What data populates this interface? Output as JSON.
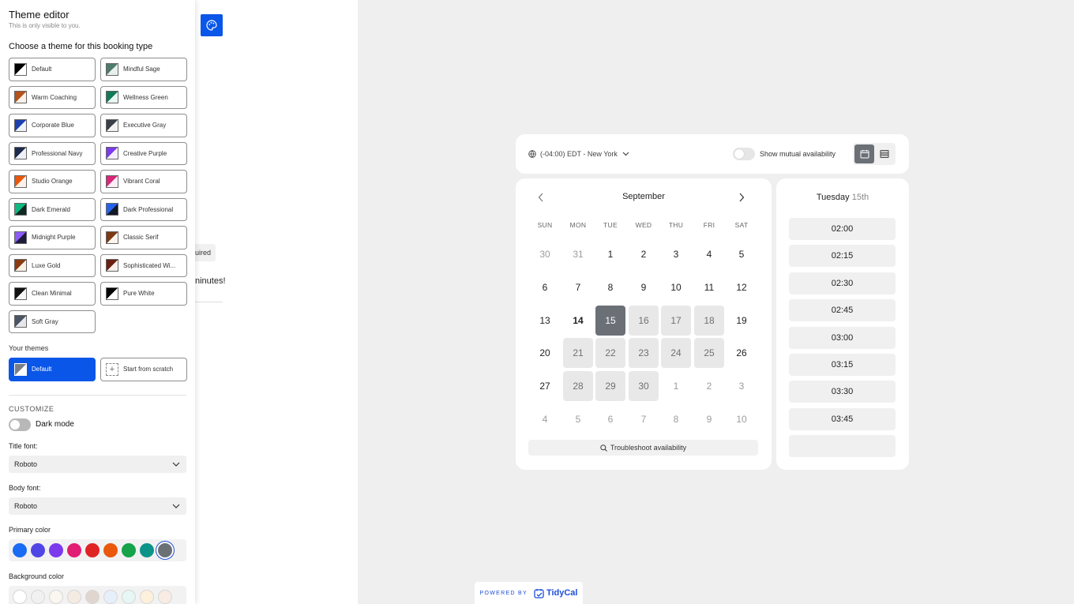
{
  "editor": {
    "title": "Theme editor",
    "subtitle": "This is only visible to you.",
    "choose_label": "Choose a theme for this booking type",
    "themes": [
      {
        "label": "Default",
        "c1": "#000000",
        "c2": "#ffffff"
      },
      {
        "label": "Mindful Sage",
        "c1": "#4f7a6e",
        "c2": "#e9efec"
      },
      {
        "label": "Warm Coaching",
        "c1": "#b4521b",
        "c2": "#fbf1e8"
      },
      {
        "label": "Wellness Green",
        "c1": "#0f7a53",
        "c2": "#e9f5ef"
      },
      {
        "label": "Corporate Blue",
        "c1": "#1e40af",
        "c2": "#eef3fb"
      },
      {
        "label": "Executive Gray",
        "c1": "#3b3f47",
        "c2": "#f3f3f4"
      },
      {
        "label": "Professional Navy",
        "c1": "#1e2b4f",
        "c2": "#eef1f7"
      },
      {
        "label": "Creative Purple",
        "c1": "#7c3aed",
        "c2": "#f4effd"
      },
      {
        "label": "Studio Orange",
        "c1": "#ea580c",
        "c2": "#fdf2ea"
      },
      {
        "label": "Vibrant Coral",
        "c1": "#db2777",
        "c2": "#fdeef5"
      },
      {
        "label": "Dark Emerald",
        "c1": "#10b981",
        "c2": "#0d2a22"
      },
      {
        "label": "Dark Professional",
        "c1": "#2563eb",
        "c2": "#111827"
      },
      {
        "label": "Midnight Purple",
        "c1": "#8b5cf6",
        "c2": "#1e1b3a"
      },
      {
        "label": "Classic Serif",
        "c1": "#7c3a12",
        "c2": "#fbf5ee"
      },
      {
        "label": "Luxe Gold",
        "c1": "#8a3b12",
        "c2": "#fbf2e4"
      },
      {
        "label": "Sophisticated Wi...",
        "c1": "#6b1f12",
        "c2": "#f8efea"
      },
      {
        "label": "Clean Minimal",
        "c1": "#111111",
        "c2": "#f7f7f7"
      },
      {
        "label": "Pure White",
        "c1": "#000000",
        "c2": "#ffffff"
      },
      {
        "label": "Soft Gray",
        "c1": "#4b5563",
        "c2": "#e5e7eb"
      }
    ],
    "your_themes_label": "Your themes",
    "your_theme_default": "Default",
    "start_scratch": "Start from scratch",
    "customize_label": "CUSTOMIZE",
    "dark_mode_label": "Dark mode",
    "title_font_label": "Title font:",
    "title_font_value": "Roboto",
    "body_font_label": "Body font:",
    "body_font_value": "Roboto",
    "primary_color_label": "Primary color",
    "primary_colors": [
      "#1a6cf2",
      "#4f46e5",
      "#7c3aed",
      "#e11d74",
      "#e02424",
      "#ea580c",
      "#16a34a",
      "#0d9488",
      "#6b6f76"
    ],
    "background_color_label": "Background color",
    "background_colors": [
      "#ffffff",
      "#f1f1f1",
      "#faf6f0",
      "#f4ebe3",
      "#e0d6cf",
      "#e6f0fb",
      "#e6f7f4",
      "#fdf1dc",
      "#f8ece4"
    ]
  },
  "page": {
    "required_chip": "uired",
    "minutes_text": "ninutes!"
  },
  "topbar": {
    "timezone": "(-04:00) EDT - New York",
    "mutual_label": "Show mutual availability"
  },
  "calendar": {
    "month": "September",
    "weekdays": [
      "SUN",
      "MON",
      "TUE",
      "WED",
      "THU",
      "FRI",
      "SAT"
    ],
    "weeks": [
      [
        {
          "d": "30",
          "s": "muted"
        },
        {
          "d": "31",
          "s": "muted"
        },
        {
          "d": "1",
          "s": ""
        },
        {
          "d": "2",
          "s": ""
        },
        {
          "d": "3",
          "s": ""
        },
        {
          "d": "4",
          "s": ""
        },
        {
          "d": "5",
          "s": ""
        }
      ],
      [
        {
          "d": "6",
          "s": ""
        },
        {
          "d": "7",
          "s": ""
        },
        {
          "d": "8",
          "s": ""
        },
        {
          "d": "9",
          "s": ""
        },
        {
          "d": "10",
          "s": ""
        },
        {
          "d": "11",
          "s": ""
        },
        {
          "d": "12",
          "s": ""
        }
      ],
      [
        {
          "d": "13",
          "s": ""
        },
        {
          "d": "14",
          "s": "today"
        },
        {
          "d": "15",
          "s": "sel"
        },
        {
          "d": "16",
          "s": "avail"
        },
        {
          "d": "17",
          "s": "avail"
        },
        {
          "d": "18",
          "s": "avail"
        },
        {
          "d": "19",
          "s": ""
        }
      ],
      [
        {
          "d": "20",
          "s": ""
        },
        {
          "d": "21",
          "s": "avail"
        },
        {
          "d": "22",
          "s": "avail"
        },
        {
          "d": "23",
          "s": "avail"
        },
        {
          "d": "24",
          "s": "avail"
        },
        {
          "d": "25",
          "s": "avail"
        },
        {
          "d": "26",
          "s": ""
        }
      ],
      [
        {
          "d": "27",
          "s": ""
        },
        {
          "d": "28",
          "s": "avail"
        },
        {
          "d": "29",
          "s": "avail"
        },
        {
          "d": "30",
          "s": "avail"
        },
        {
          "d": "1",
          "s": "muted"
        },
        {
          "d": "2",
          "s": "muted"
        },
        {
          "d": "3",
          "s": "muted"
        }
      ],
      [
        {
          "d": "4",
          "s": "muted"
        },
        {
          "d": "5",
          "s": "muted"
        },
        {
          "d": "6",
          "s": "muted"
        },
        {
          "d": "7",
          "s": "muted"
        },
        {
          "d": "8",
          "s": "muted"
        },
        {
          "d": "9",
          "s": "muted"
        },
        {
          "d": "10",
          "s": "muted"
        }
      ]
    ],
    "troubleshoot": "Troubleshoot availability"
  },
  "slots": {
    "day_name": "Tuesday",
    "day_num": "15th",
    "times": [
      "02:00",
      "02:15",
      "02:30",
      "02:45",
      "03:00",
      "03:15",
      "03:30",
      "03:45",
      ""
    ]
  },
  "footer": {
    "powered_by": "POWERED BY",
    "brand": "TidyCal"
  }
}
